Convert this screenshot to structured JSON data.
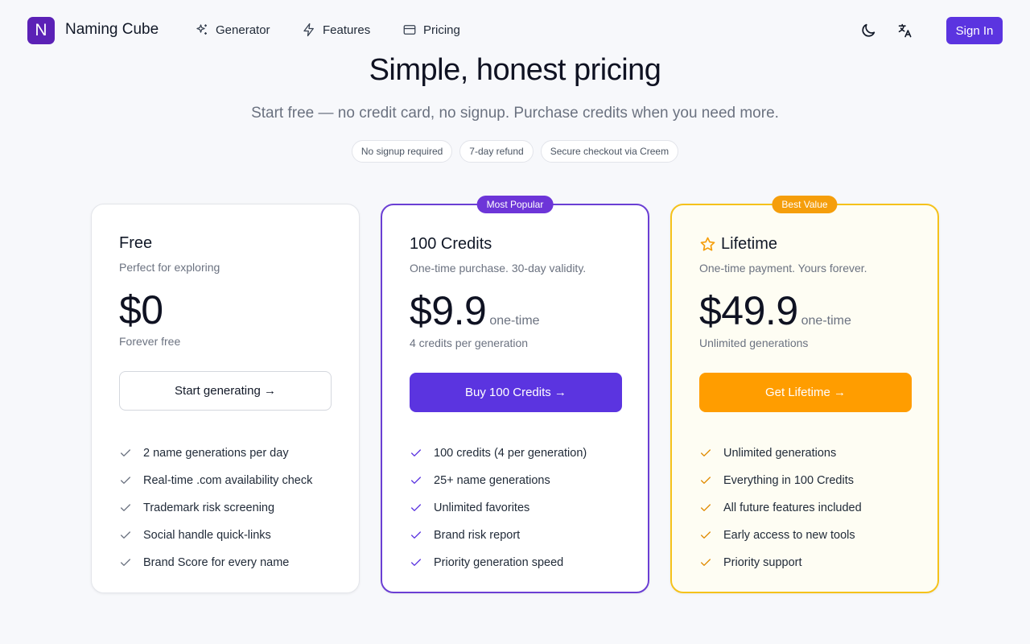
{
  "header": {
    "logo_letter": "N",
    "brand": "Naming Cube",
    "nav": [
      {
        "label": "Generator",
        "icon": "sparkles-icon"
      },
      {
        "label": "Features",
        "icon": "lightning-icon"
      },
      {
        "label": "Pricing",
        "icon": "credit-card-icon"
      }
    ],
    "theme_icon": "moon-icon",
    "language_icon": "translate-icon",
    "sign_in": "Sign In"
  },
  "hero": {
    "title": "Simple, honest pricing",
    "subtitle": "Start free — no credit card, no signup. Purchase credits when you need more.",
    "pills": [
      "No signup required",
      "7-day refund",
      "Secure checkout via Creem"
    ]
  },
  "plans": [
    {
      "name": "Free",
      "description": "Perfect for exploring",
      "price": "$0",
      "price_unit": "",
      "note": "Forever free",
      "cta": "Start generating →",
      "features": [
        "2 name generations per day",
        "Real-time .com availability check",
        "Trademark risk screening",
        "Social handle quick-links",
        "Brand Score for every name"
      ]
    },
    {
      "name": "100 Credits",
      "badge": "Most Popular",
      "description": "One-time purchase. 30-day validity.",
      "price": "$9.9",
      "price_unit": "one-time",
      "note": "4 credits per generation",
      "cta": "Buy 100 Credits →",
      "features": [
        "100 credits (4 per generation)",
        "25+ name generations",
        "Unlimited favorites",
        "Brand risk report",
        "Priority generation speed"
      ]
    },
    {
      "name": "Lifetime",
      "badge": "Best Value",
      "description": "One-time payment. Yours forever.",
      "price": "$49.9",
      "price_unit": "one-time",
      "note": "Unlimited generations",
      "cta": "Get Lifetime →",
      "features": [
        "Unlimited generations",
        "Everything in 100 Credits",
        "All future features included",
        "Early access to new tools",
        "Priority support"
      ]
    }
  ],
  "colors": {
    "primary": "#5b34e0",
    "accent_orange": "#ff9d00",
    "lifetime_border": "#f5c21b",
    "check_gray": "#6b7280",
    "check_purple": "#5b34e0",
    "check_orange": "#e08a00"
  }
}
